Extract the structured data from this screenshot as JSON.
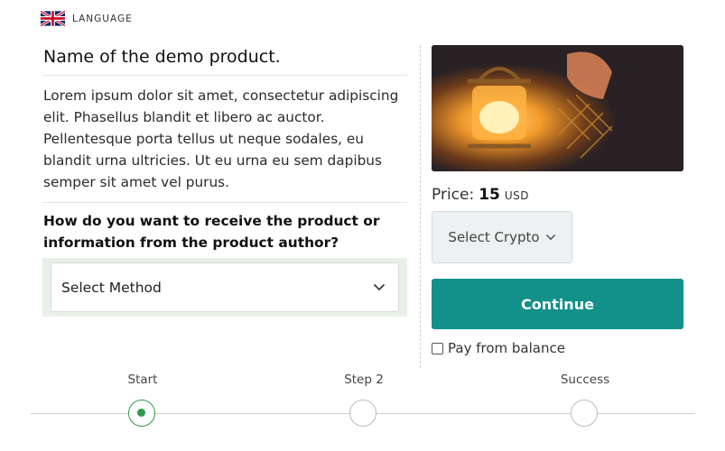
{
  "header": {
    "language_label": "LANGUAGE",
    "flag_icon": "uk-flag-icon"
  },
  "product": {
    "name": "Name of the demo product.",
    "description": "Lorem ipsum dolor sit amet, consectetur adipiscing elit. Phasellus blandit et libero ac auctor. Pellentesque porta tellus ut neque sodales, eu blandit urna ultricies. Ut eu urna eu sem dapibus semper sit amet vel purus.",
    "image_icon": "lantern-photo"
  },
  "delivery": {
    "question": "How do you want to receive the product or information from the product author?",
    "select_value": "Select Method"
  },
  "price": {
    "label": "Price:",
    "amount": "15",
    "currency": "USD"
  },
  "crypto": {
    "select_value": "Select Crypto"
  },
  "actions": {
    "continue_label": "Continue",
    "pay_balance_label": "Pay from balance",
    "pay_balance_checked": false
  },
  "steps": [
    {
      "label": "Start",
      "active": true
    },
    {
      "label": "Step 2",
      "active": false
    },
    {
      "label": "Success",
      "active": false
    }
  ],
  "colors": {
    "accent": "#12918a",
    "step_active": "#2e9a4c",
    "method_bg": "#e8f0e8"
  }
}
